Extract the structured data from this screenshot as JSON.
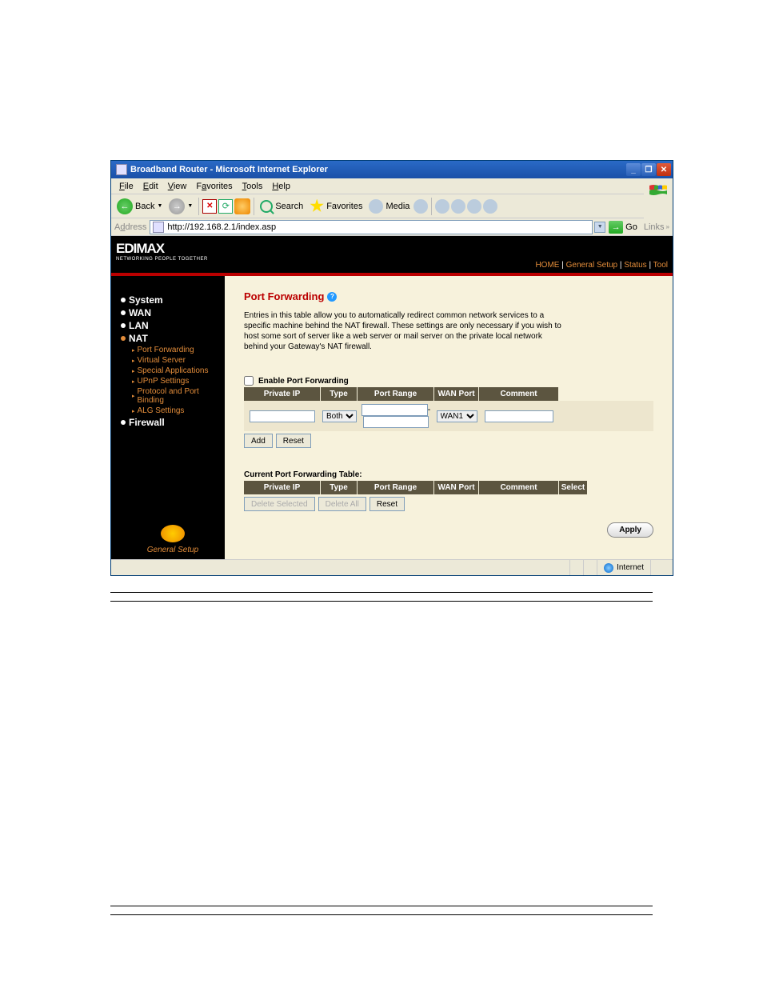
{
  "window": {
    "title": "Broadband Router - Microsoft Internet Explorer"
  },
  "menu": {
    "file": "File",
    "edit": "Edit",
    "view": "View",
    "favorites": "Favorites",
    "tools": "Tools",
    "help": "Help"
  },
  "toolbar": {
    "back": "Back",
    "search": "Search",
    "favorites": "Favorites",
    "media": "Media"
  },
  "address": {
    "label": "Address",
    "url": "http://192.168.2.1/index.asp",
    "go": "Go",
    "links": "Links"
  },
  "logo": {
    "name": "EDIMAX",
    "tagline": "NETWORKING PEOPLE TOGETHER"
  },
  "topnav": {
    "home": "HOME",
    "general": "General Setup",
    "status": "Status",
    "tool": "Tool"
  },
  "sidebar": {
    "system": "System",
    "wan": "WAN",
    "lan": "LAN",
    "nat": "NAT",
    "sub": {
      "portfwd": "Port Forwarding",
      "vserver": "Virtual Server",
      "special": "Special Applications",
      "upnp": "UPnP Settings",
      "protobind": "Protocol and Port Binding",
      "alg": "ALG Settings"
    },
    "firewall": "Firewall",
    "footer": "General Setup"
  },
  "main": {
    "title": "Port Forwarding",
    "desc": "Entries in this table allow you to automatically redirect common network services to a specific machine behind the NAT firewall. These settings are only necessary if you wish to host some sort of server like a web server or mail server on the private local network behind your Gateway's NAT firewall.",
    "enable": "Enable Port Forwarding",
    "cols": {
      "ip": "Private IP",
      "type": "Type",
      "range": "Port Range",
      "wan": "WAN Port",
      "comment": "Comment",
      "select": "Select"
    },
    "type_options": [
      "Both"
    ],
    "type_selected": "Both",
    "wan_options": [
      "WAN1"
    ],
    "wan_selected": "WAN1",
    "add": "Add",
    "reset": "Reset",
    "table_title": "Current Port Forwarding Table:",
    "del_sel": "Delete Selected",
    "del_all": "Delete All",
    "apply": "Apply"
  },
  "status": {
    "zone": "Internet"
  }
}
